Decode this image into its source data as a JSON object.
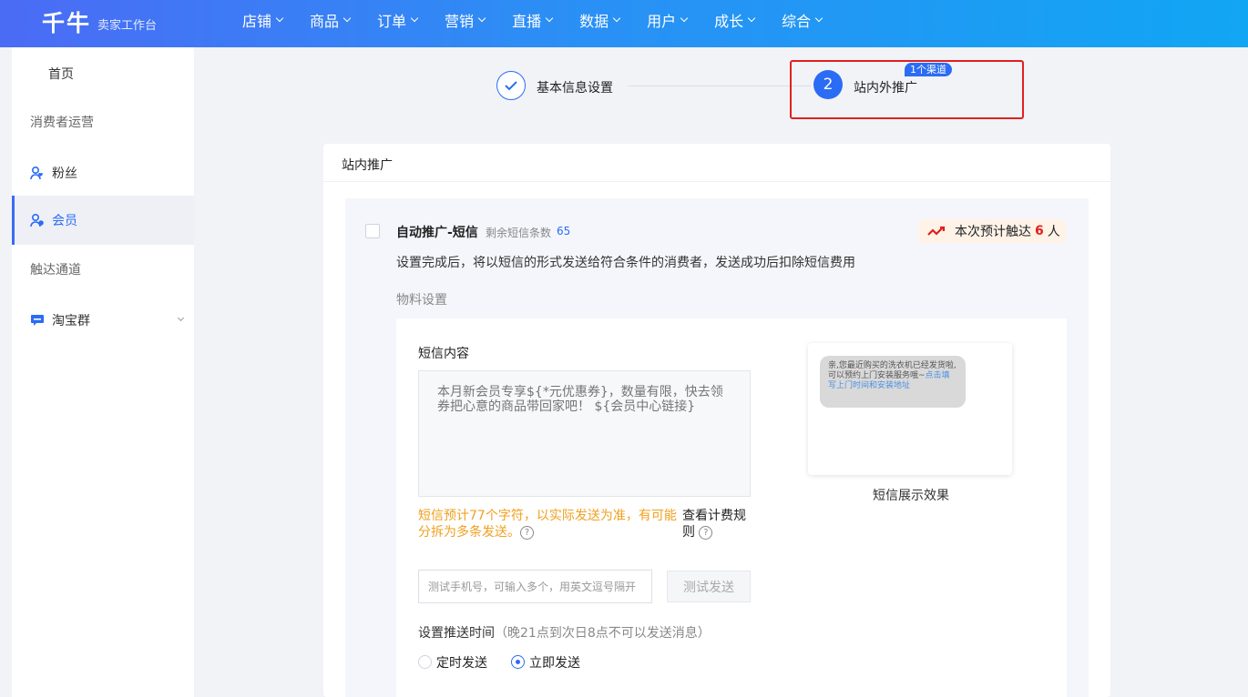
{
  "header": {
    "logo": "千牛",
    "subtitle": "卖家工作台",
    "nav": [
      "店铺",
      "商品",
      "订单",
      "营销",
      "直播",
      "数据",
      "用户",
      "成长",
      "综合"
    ]
  },
  "sidebar": {
    "items": [
      {
        "label": "首页",
        "type": "item"
      },
      {
        "label": "消费者运营",
        "type": "group"
      },
      {
        "label": "粉丝",
        "type": "item",
        "icon": "fans-icon"
      },
      {
        "label": "会员",
        "type": "item",
        "icon": "member-icon",
        "active": true
      },
      {
        "label": "触达通道",
        "type": "group"
      },
      {
        "label": "淘宝群",
        "type": "item",
        "icon": "chat-icon"
      }
    ]
  },
  "steps": {
    "step1": "基本信息设置",
    "step2_num": "2",
    "step2": "站内外推广",
    "badge": "1个渠道"
  },
  "card": {
    "title": "站内推广",
    "sms_title": "自动推广-短信",
    "remain_label": "剩余短信条数",
    "remain_count": "65",
    "reach_prefix": "本次预计触达",
    "reach_count": "6",
    "reach_suffix": "人",
    "desc": "设置完成后，将以短信的形式发送给符合条件的消费者，发送成功后扣除短信费用",
    "material_label": "物料设置",
    "sms_content_label": "短信内容",
    "sms_placeholder": "本月新会员专享${*元优惠券}，数量有限，快去领券把心意的商品带回家吧！ ${会员中心链接}",
    "warn_text": "短信预计77个字符，以实际发送为准，有可能分拆为多条发送。",
    "rule_link": "查看计费规则",
    "phone_placeholder": "测试手机号，可输入多个，用英文逗号隔开",
    "test_button": "测试发送",
    "time_label": "设置推送时间",
    "time_hint": "（晚21点到次日8点不可以发送消息）",
    "radio_scheduled": "定时发送",
    "radio_now": "立即发送",
    "preview_text": "亲,您最近购买的洗衣机已经发货啦,可以预约上门安装服务哦~",
    "preview_link": "点击填写上门时间和安装地址",
    "preview_caption": "短信展示效果"
  },
  "colors": {
    "accent": "#2b6cf5",
    "warning": "#f0a020",
    "highlight": "#e02020"
  }
}
